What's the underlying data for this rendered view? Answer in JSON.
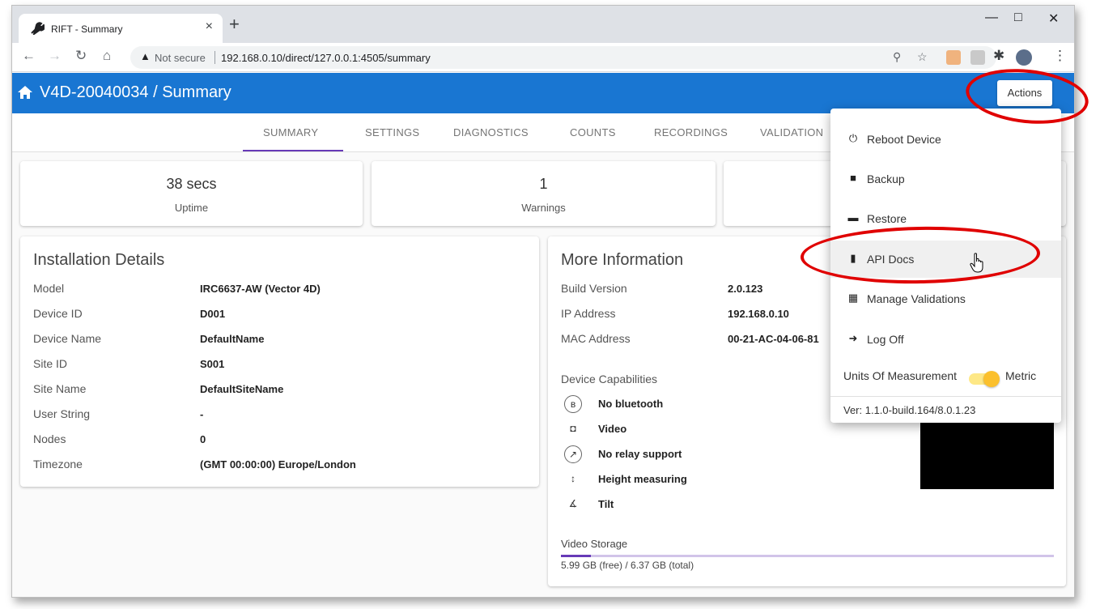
{
  "browser": {
    "tab_title": "RIFT - Summary",
    "tab_close": "×",
    "new_tab": "+",
    "not_secure": "Not secure",
    "url": "192.168.0.10/direct/127.0.0.1:4505/summary"
  },
  "app": {
    "title": "V4D-20040034 / Summary",
    "actions_label": "Actions",
    "brand_color": "#1976d2",
    "accent_color": "#673ab7"
  },
  "nav": {
    "tabs": [
      "SUMMARY",
      "SETTINGS",
      "DIAGNOSTICS",
      "COUNTS",
      "RECORDINGS",
      "VALIDATION"
    ],
    "active": "SUMMARY"
  },
  "stats": [
    {
      "value": "38 secs",
      "label": "Uptime"
    },
    {
      "value": "1",
      "label": "Warnings"
    }
  ],
  "installation": {
    "title": "Installation Details",
    "rows": [
      {
        "label": "Model",
        "value": "IRC6637-AW (Vector 4D)"
      },
      {
        "label": "Device ID",
        "value": "D001"
      },
      {
        "label": "Device Name",
        "value": "DefaultName"
      },
      {
        "label": "Site ID",
        "value": "S001"
      },
      {
        "label": "Site Name",
        "value": "DefaultSiteName"
      },
      {
        "label": "User String",
        "value": "-"
      },
      {
        "label": "Nodes",
        "value": "0"
      },
      {
        "label": "Timezone",
        "value": "(GMT 00:00:00) Europe/London"
      }
    ]
  },
  "more_info": {
    "title": "More Information",
    "rows": [
      {
        "label": "Build Version",
        "value": "2.0.123"
      },
      {
        "label": "IP Address",
        "value": "192.168.0.10"
      },
      {
        "label": "MAC Address",
        "value": "00-21-AC-04-06-81"
      }
    ],
    "capabilities_title": "Device Capabilities",
    "capabilities": [
      {
        "icon": "bluetooth-disabled-icon",
        "glyph": "ʙ",
        "label": "No bluetooth"
      },
      {
        "icon": "camera-icon",
        "glyph": "◘",
        "label": "Video"
      },
      {
        "icon": "relay-off-icon",
        "glyph": "↗",
        "label": "No relay support"
      },
      {
        "icon": "height-icon",
        "glyph": "↕",
        "label": "Height measuring"
      },
      {
        "icon": "tilt-icon",
        "glyph": "∡",
        "label": "Tilt"
      }
    ],
    "storage_title": "Video Storage",
    "storage_text": "5.99 GB (free) / 6.37 GB (total)",
    "storage_used_fraction": 0.06
  },
  "menu": {
    "items": [
      {
        "name": "reboot-device",
        "icon": "power-icon",
        "glyph": "⏻",
        "label": "Reboot Device"
      },
      {
        "name": "backup",
        "icon": "save-icon",
        "glyph": "■",
        "label": "Backup"
      },
      {
        "name": "restore",
        "icon": "folder-open-icon",
        "glyph": "▬",
        "label": "Restore"
      },
      {
        "name": "api-docs",
        "icon": "book-icon",
        "glyph": "▮",
        "label": "API Docs"
      },
      {
        "name": "manage-validations",
        "icon": "film-icon",
        "glyph": "▦",
        "label": "Manage Validations"
      },
      {
        "name": "log-off",
        "icon": "sign-out-icon",
        "glyph": "➜",
        "label": "Log Off"
      }
    ],
    "units_label": "Units Of Measurement",
    "units_value": "Metric",
    "version": "Ver: 1.1.0-build.164/8.0.1.23"
  }
}
